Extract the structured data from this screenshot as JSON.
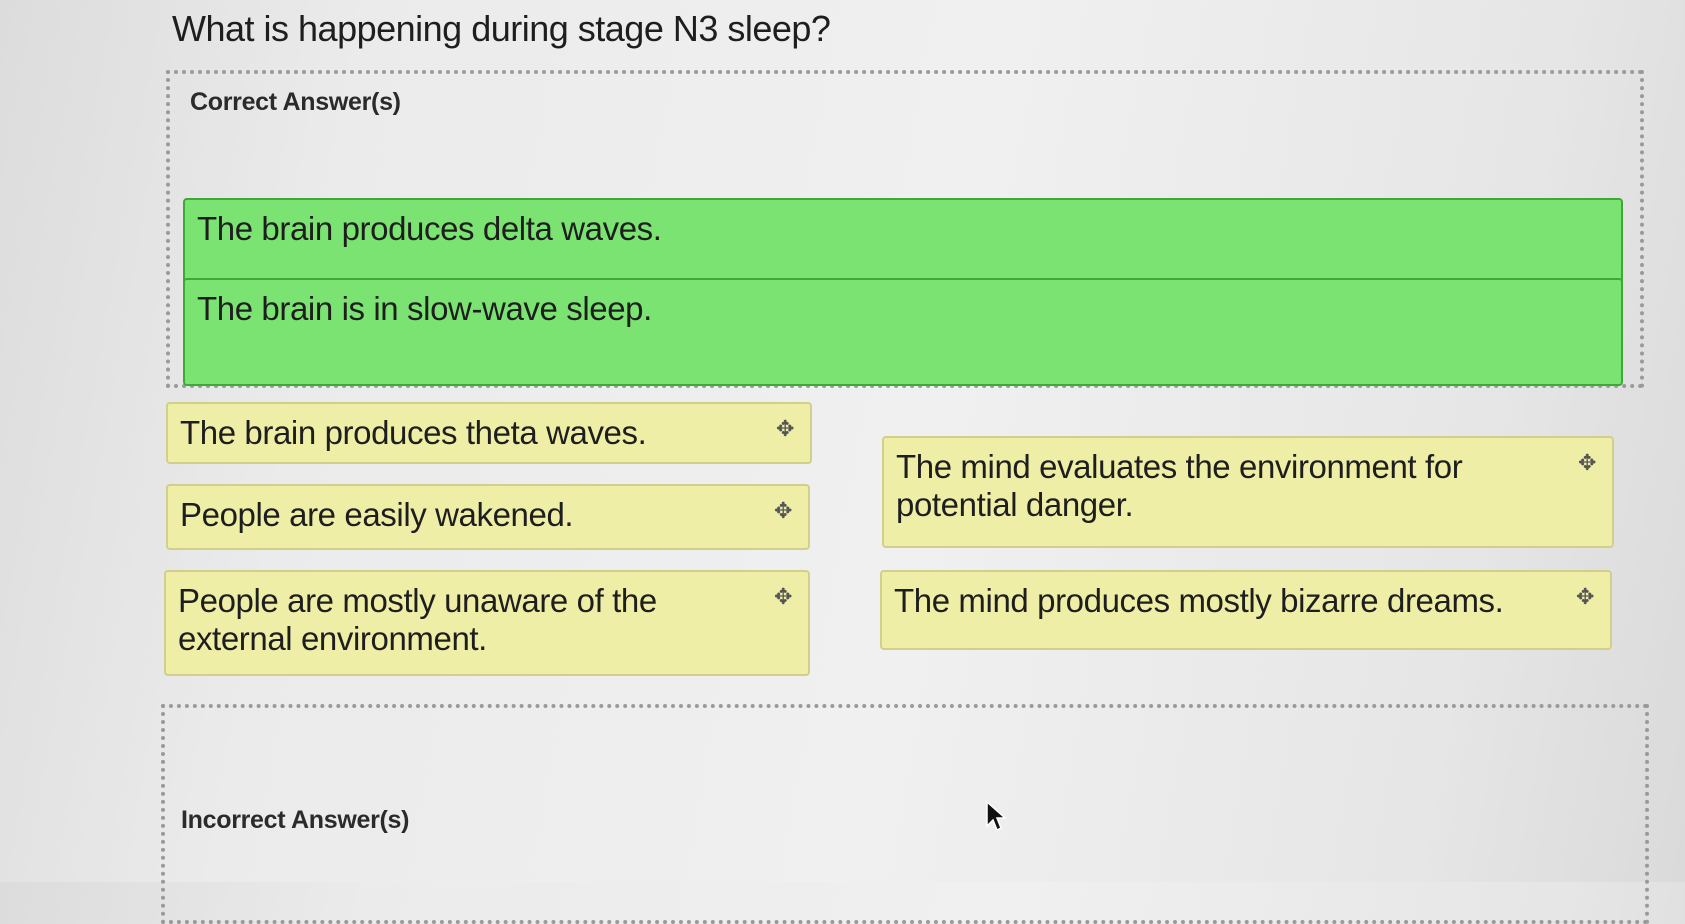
{
  "question": "What is happening during stage N3 sleep?",
  "correct_zone": {
    "heading": "Correct Answer(s)",
    "items": [
      "The brain produces delta waves.",
      "The brain is in slow-wave sleep."
    ]
  },
  "options": {
    "left": [
      "The brain produces theta waves.",
      "People are easily wakened.",
      "People are mostly unaware of the external environment."
    ],
    "right": [
      "The mind evaluates the environment for potential danger.",
      "The mind produces mostly bizarre dreams."
    ],
    "drag_icon": "move-icon"
  },
  "incorrect_zone": {
    "heading": "Incorrect Answer(s)"
  },
  "colors": {
    "correct_fill": "#7be371",
    "option_fill": "#eeeea6"
  }
}
